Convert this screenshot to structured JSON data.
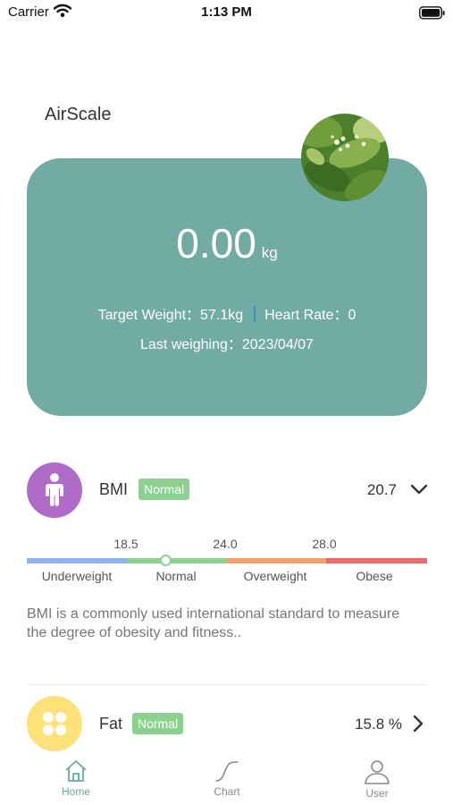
{
  "status_bar": {
    "carrier": "Carrier",
    "time": "1:13 PM"
  },
  "app": {
    "title": "AirScale"
  },
  "weight_card": {
    "value": "0.00",
    "unit": "kg",
    "target_weight": "Target Weight：57.1kg",
    "heart_rate": "Heart Rate：0",
    "last_weighing": "Last weighing：2023/04/07",
    "color": "#71aba3"
  },
  "bmi": {
    "name": "BMI",
    "status": "Normal",
    "value": "20.7",
    "icon": "person-icon",
    "icon_color": "#b06ac8",
    "thresholds": [
      "18.5",
      "24.0",
      "28.0"
    ],
    "categories": [
      {
        "label": "Underweight",
        "color": "#8fb3ea"
      },
      {
        "label": "Normal",
        "color": "#8cd18f"
      },
      {
        "label": "Overweight",
        "color": "#f2a172"
      },
      {
        "label": "Obese",
        "color": "#e96b6b"
      }
    ],
    "description": "BMI is a commonly used international standard to measure the degree of obesity and fitness.."
  },
  "fat": {
    "name": "Fat",
    "status": "Normal",
    "value": "15.8 %",
    "icon": "four-dots-icon",
    "icon_color": "#ffe17a"
  },
  "tabs": [
    {
      "label": "Home",
      "icon": "home-icon",
      "active": true
    },
    {
      "label": "Chart",
      "icon": "curve-icon",
      "active": false
    },
    {
      "label": "User",
      "icon": "user-icon",
      "active": false
    }
  ],
  "colors": {
    "accent": "#71aba3",
    "badge": "#8cd18f",
    "tab_active": "#6aa9a0",
    "tab_inactive": "#8a8a8a"
  }
}
